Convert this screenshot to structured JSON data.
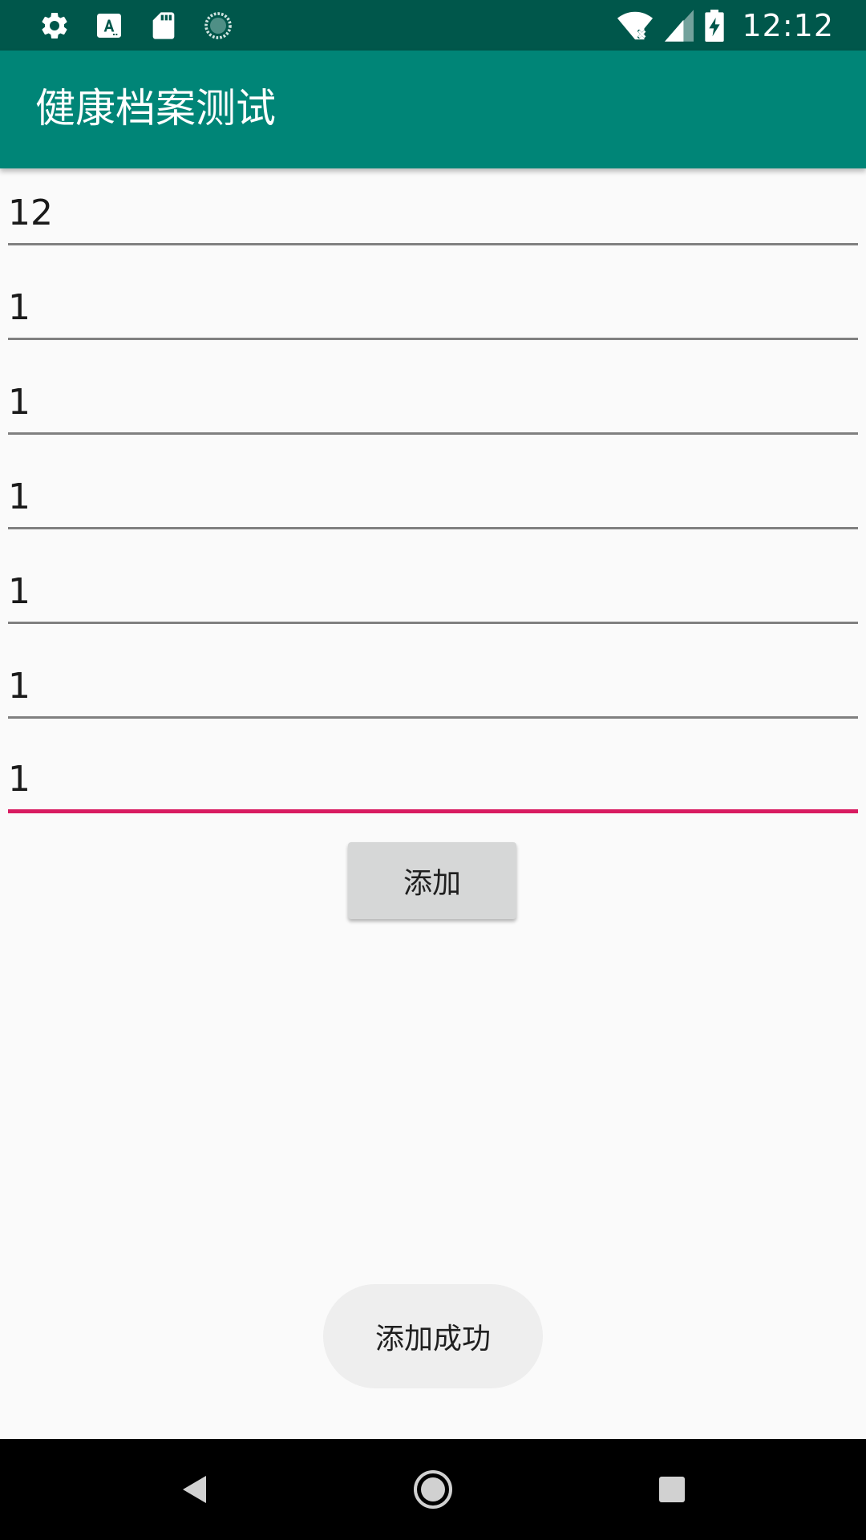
{
  "status_bar": {
    "time": "12:12",
    "icons": [
      "gear-icon",
      "font-a-icon",
      "sd-card-icon",
      "sync-icon",
      "wifi-off-icon",
      "cell-signal-icon",
      "battery-charging-icon"
    ]
  },
  "app_bar": {
    "title": "健康档案测试"
  },
  "form": {
    "fields": [
      {
        "value": "12"
      },
      {
        "value": "1"
      },
      {
        "value": "1"
      },
      {
        "value": "1"
      },
      {
        "value": "1"
      },
      {
        "value": "1"
      },
      {
        "value": "1"
      }
    ],
    "add_button_label": "添加"
  },
  "toast": {
    "message": "添加成功"
  },
  "nav_bar": {
    "icons": [
      "back-icon",
      "home-icon",
      "recents-icon"
    ]
  },
  "colors": {
    "status_bar": "#00574b",
    "app_bar": "#008577",
    "accent": "#d81b60",
    "background": "#fafafa",
    "button": "#d6d7d7",
    "toast": "#eeeeee"
  }
}
